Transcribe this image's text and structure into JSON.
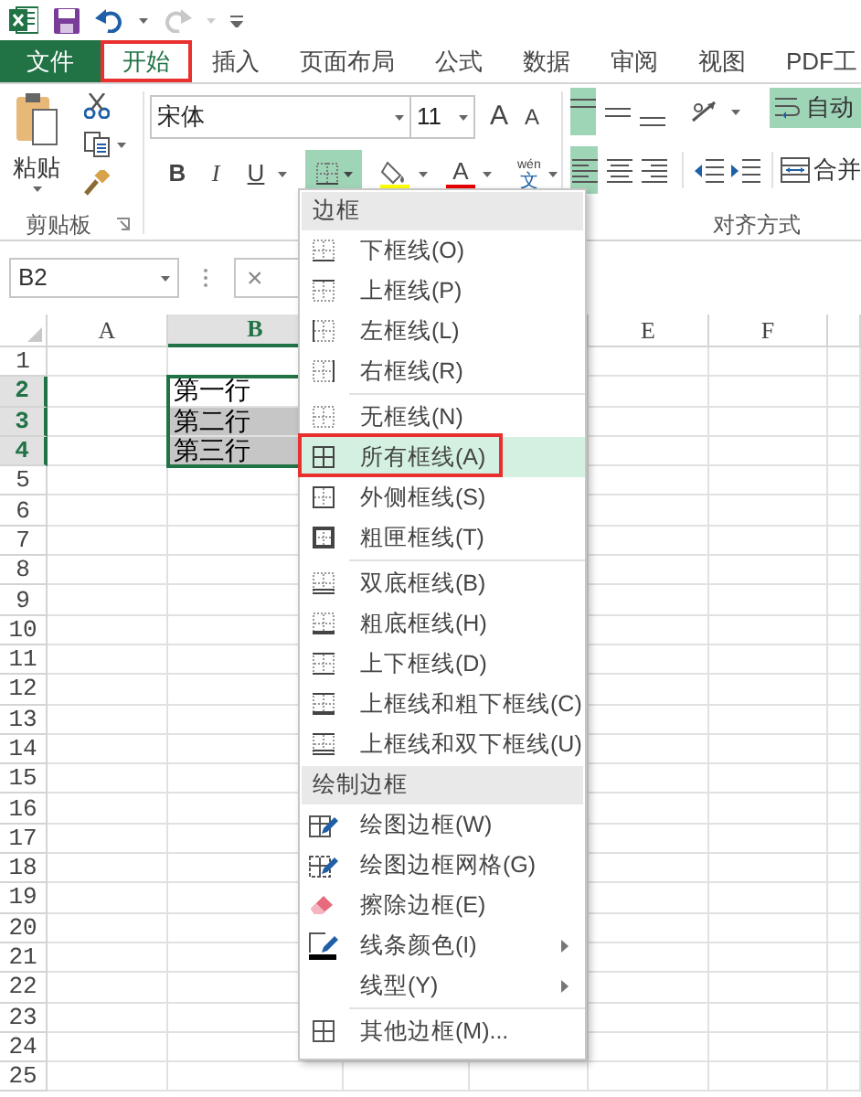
{
  "quick_access": {
    "redo_disabled": true
  },
  "tabs": [
    {
      "label": "文件",
      "kind": "file",
      "selected": false,
      "annotated": false
    },
    {
      "label": "开始",
      "kind": "tab",
      "selected": true,
      "annotated": true
    },
    {
      "label": "插入",
      "kind": "tab",
      "selected": false,
      "annotated": false
    },
    {
      "label": "页面布局",
      "kind": "tab",
      "selected": false,
      "annotated": false
    },
    {
      "label": "公式",
      "kind": "tab",
      "selected": false,
      "annotated": false
    },
    {
      "label": "数据",
      "kind": "tab",
      "selected": false,
      "annotated": false
    },
    {
      "label": "审阅",
      "kind": "tab",
      "selected": false,
      "annotated": false
    },
    {
      "label": "视图",
      "kind": "tab",
      "selected": false,
      "annotated": false
    },
    {
      "label": "PDF工",
      "kind": "tab",
      "selected": false,
      "annotated": false
    }
  ],
  "ribbon": {
    "clipboard": {
      "paste_label": "粘贴",
      "group_label": "剪贴板"
    },
    "font": {
      "font_name": "宋体",
      "font_size": "11",
      "grow": "A",
      "shrink": "A",
      "bold": "B",
      "italic": "I",
      "underline": "U",
      "borders_pressed": true,
      "font_color_letter": "A",
      "phonetic_top": "wén",
      "phonetic_bottom": "文"
    },
    "alignment": {
      "top_align_pressed": true,
      "middle_align_pressed": false,
      "bottom_align_pressed": false,
      "left_align_pressed": true,
      "center_pressed": false,
      "right_pressed": false,
      "wrap_label": "自动",
      "wrap_pressed": true,
      "merge_label": "合并",
      "group_label": "对齐方式"
    }
  },
  "formula_bar": {
    "name_box": "B2",
    "cancel": "×"
  },
  "columns": [
    {
      "label": "A",
      "selected": false
    },
    {
      "label": "B",
      "selected": true
    },
    {
      "label": "E",
      "selected": false
    },
    {
      "label": "F",
      "selected": false
    }
  ],
  "rows": [
    {
      "label": "1",
      "selected": false
    },
    {
      "label": "2",
      "selected": true,
      "cell_b": "第一行",
      "shaded": false
    },
    {
      "label": "3",
      "selected": true,
      "cell_b": "第二行",
      "shaded": true
    },
    {
      "label": "4",
      "selected": true,
      "cell_b": "第三行",
      "shaded": true
    },
    {
      "label": "5",
      "selected": false
    },
    {
      "label": "6",
      "selected": false
    },
    {
      "label": "7",
      "selected": false
    },
    {
      "label": "8",
      "selected": false
    },
    {
      "label": "9",
      "selected": false
    },
    {
      "label": "10",
      "selected": false
    },
    {
      "label": "11",
      "selected": false
    },
    {
      "label": "12",
      "selected": false
    },
    {
      "label": "13",
      "selected": false
    },
    {
      "label": "14",
      "selected": false
    },
    {
      "label": "15",
      "selected": false
    },
    {
      "label": "16",
      "selected": false
    },
    {
      "label": "17",
      "selected": false
    },
    {
      "label": "18",
      "selected": false
    },
    {
      "label": "19",
      "selected": false
    },
    {
      "label": "20",
      "selected": false
    },
    {
      "label": "21",
      "selected": false
    },
    {
      "label": "22",
      "selected": false
    },
    {
      "label": "23",
      "selected": false
    },
    {
      "label": "24",
      "selected": false
    },
    {
      "label": "25",
      "selected": false
    }
  ],
  "border_menu": {
    "sections": [
      {
        "title": "边框",
        "items": [
          {
            "label": "下框线(O)",
            "selected": false,
            "annotated": false,
            "separator_before": false,
            "submenu": false
          },
          {
            "label": "上框线(P)",
            "selected": false,
            "annotated": false,
            "separator_before": false,
            "submenu": false
          },
          {
            "label": "左框线(L)",
            "selected": false,
            "annotated": false,
            "separator_before": false,
            "submenu": false
          },
          {
            "label": "右框线(R)",
            "selected": false,
            "annotated": false,
            "separator_before": false,
            "submenu": false
          },
          {
            "label": "无框线(N)",
            "selected": false,
            "annotated": false,
            "separator_before": true,
            "submenu": false
          },
          {
            "label": "所有框线(A)",
            "selected": true,
            "annotated": true,
            "separator_before": false,
            "submenu": false
          },
          {
            "label": "外侧框线(S)",
            "selected": false,
            "annotated": false,
            "separator_before": false,
            "submenu": false
          },
          {
            "label": "粗匣框线(T)",
            "selected": false,
            "annotated": false,
            "separator_before": false,
            "submenu": false
          },
          {
            "label": "双底框线(B)",
            "selected": false,
            "annotated": false,
            "separator_before": true,
            "submenu": false
          },
          {
            "label": "粗底框线(H)",
            "selected": false,
            "annotated": false,
            "separator_before": false,
            "submenu": false
          },
          {
            "label": "上下框线(D)",
            "selected": false,
            "annotated": false,
            "separator_before": false,
            "submenu": false
          },
          {
            "label": "上框线和粗下框线(C)",
            "selected": false,
            "annotated": false,
            "separator_before": false,
            "submenu": false
          },
          {
            "label": "上框线和双下框线(U)",
            "selected": false,
            "annotated": false,
            "separator_before": false,
            "submenu": false
          }
        ]
      },
      {
        "title": "绘制边框",
        "items": [
          {
            "label": "绘图边框(W)",
            "selected": false,
            "annotated": false,
            "separator_before": false,
            "submenu": false
          },
          {
            "label": "绘图边框网格(G)",
            "selected": false,
            "annotated": false,
            "separator_before": false,
            "submenu": false
          },
          {
            "label": "擦除边框(E)",
            "selected": false,
            "annotated": false,
            "separator_before": false,
            "submenu": false
          },
          {
            "label": "线条颜色(I)",
            "selected": false,
            "annotated": false,
            "separator_before": false,
            "submenu": true
          },
          {
            "label": "线型(Y)",
            "selected": false,
            "annotated": false,
            "separator_before": false,
            "submenu": true
          },
          {
            "label": "其他边框(M)...",
            "selected": false,
            "annotated": false,
            "separator_before": true,
            "submenu": false
          }
        ]
      }
    ]
  }
}
